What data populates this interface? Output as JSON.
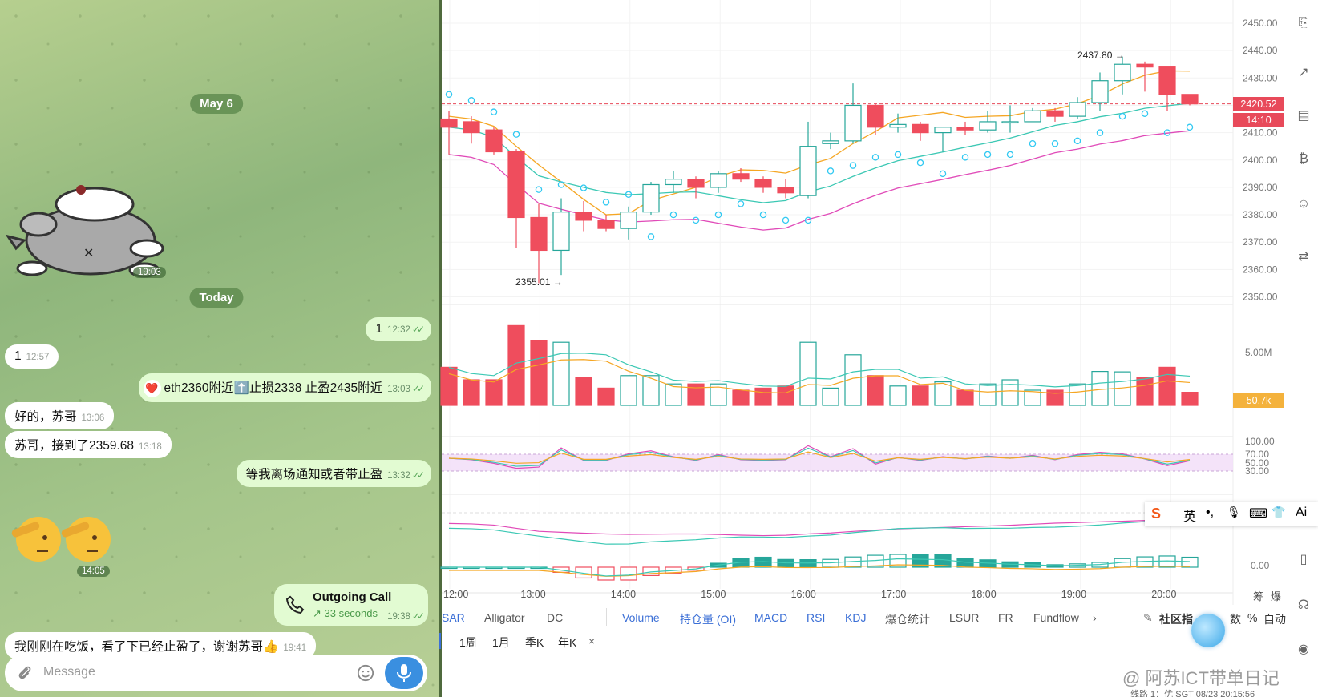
{
  "chat": {
    "date_may": "May 6",
    "date_today": "Today",
    "sticker1_time": "19:03",
    "sticker2_time": "14:05",
    "messages": [
      {
        "text": "1",
        "time": "12:32",
        "dir": "out"
      },
      {
        "text": "1",
        "time": "12:57",
        "dir": "in"
      },
      {
        "text": "eth2360附近⬆️止损2338 止盈2435附近",
        "time": "13:03",
        "dir": "out",
        "reaction": "❤️"
      },
      {
        "text": "好的，苏哥",
        "time": "13:06",
        "dir": "in"
      },
      {
        "text": "苏哥，接到了2359.68",
        "time": "13:18",
        "dir": "in"
      },
      {
        "text": "等我离场通知或者带止盈",
        "time": "13:32",
        "dir": "out"
      },
      {
        "text": "我刚刚在吃饭，看了下已经止盈了，谢谢苏哥👍",
        "time": "19:41",
        "dir": "in"
      }
    ],
    "call": {
      "title": "Outgoing Call",
      "detail": "↗ 33 seconds",
      "time": "19:38"
    },
    "input_placeholder": "Message",
    "icons": {
      "attach": "paperclip-icon",
      "emoji": "emoji-icon",
      "mic": "microphone-icon",
      "call": "phone-icon"
    }
  },
  "chart": {
    "price_axis": [
      "2450.00",
      "2440.00",
      "2430.00",
      "2420.00",
      "2410.00",
      "2400.00",
      "2390.00",
      "2380.00",
      "2370.00",
      "2360.00",
      "2350.00"
    ],
    "current_price": "2420.52",
    "countdown": "14:10",
    "volume_axis": "5.00M",
    "volume_current": "50.7k",
    "rsi_axis": [
      "100.00",
      "70.00",
      "50.00",
      "30.00"
    ],
    "macd_axis": "0.00",
    "time_axis": [
      "12:00",
      "13:00",
      "14:00",
      "15:00",
      "16:00",
      "17:00",
      "18:00",
      "19:00",
      "20:00"
    ],
    "high_label": "2437.80",
    "low_label": "2355.01",
    "chip_label": "筹",
    "burst_label": "爆",
    "colors": {
      "up": "#26a69a",
      "down": "#ef4d5d",
      "price_tag": "#e84a5a",
      "volume_tag": "#f4b23c"
    }
  },
  "chart_data": {
    "type": "candlestick",
    "x": [
      "12:00",
      "12:15",
      "12:30",
      "12:45",
      "13:00",
      "13:15",
      "13:30",
      "13:45",
      "14:00",
      "14:15",
      "14:30",
      "14:45",
      "15:00",
      "15:15",
      "15:30",
      "15:45",
      "16:00",
      "16:15",
      "16:30",
      "16:45",
      "17:00",
      "17:15",
      "17:30",
      "17:45",
      "18:00",
      "18:15",
      "18:30",
      "18:45",
      "19:00",
      "19:15",
      "19:30",
      "19:45",
      "20:00",
      "20:15"
    ],
    "series": [
      {
        "name": "",
        "ohlc": [
          [
            2415,
            2418,
            2402,
            2412
          ],
          [
            2414,
            2416,
            2406,
            2410
          ],
          [
            2411,
            2412,
            2402,
            2403
          ],
          [
            2403,
            2404,
            2368,
            2379
          ],
          [
            2379,
            2384,
            2355,
            2367
          ],
          [
            2367,
            2386,
            2358,
            2381
          ],
          [
            2381,
            2385,
            2374,
            2378
          ],
          [
            2378,
            2380,
            2374,
            2375
          ],
          [
            2375,
            2383,
            2371,
            2381
          ],
          [
            2381,
            2392,
            2380,
            2391
          ],
          [
            2391,
            2396,
            2388,
            2393
          ],
          [
            2393,
            2394,
            2386,
            2390
          ],
          [
            2390,
            2396,
            2388,
            2395
          ],
          [
            2395,
            2397,
            2392,
            2393
          ],
          [
            2393,
            2394,
            2388,
            2390
          ],
          [
            2390,
            2393,
            2386,
            2388
          ],
          [
            2387,
            2414,
            2386,
            2405
          ],
          [
            2406,
            2410,
            2404,
            2407
          ],
          [
            2407,
            2428,
            2406,
            2420
          ],
          [
            2420,
            2421,
            2409,
            2412
          ],
          [
            2412,
            2417,
            2410,
            2413
          ],
          [
            2413,
            2414,
            2407,
            2410
          ],
          [
            2410,
            2412,
            2403,
            2412
          ],
          [
            2412,
            2414,
            2409,
            2411
          ],
          [
            2411,
            2418,
            2410,
            2414
          ],
          [
            2414,
            2420,
            2410,
            2414
          ],
          [
            2414,
            2419,
            2414,
            2418
          ],
          [
            2418,
            2419,
            2414,
            2416
          ],
          [
            2416,
            2423,
            2415,
            2421
          ],
          [
            2421,
            2432,
            2418,
            2429
          ],
          [
            2429,
            2437.8,
            2424,
            2435
          ],
          [
            2435,
            2436,
            2425,
            2434
          ],
          [
            2434,
            2434,
            2418,
            2424
          ],
          [
            2424,
            2424,
            2420,
            2420.52
          ]
        ]
      }
    ],
    "ylim": [
      2345,
      2453
    ],
    "annotations": {
      "high": 2437.8,
      "low": 2355.01,
      "last": 2420.52
    }
  },
  "toolbar": {
    "indicators_left": [
      "SAR",
      "Alligator",
      "DC"
    ],
    "indicators_right": [
      "Volume",
      "持仓量 (OI)",
      "MACD",
      "RSI",
      "KDJ",
      "爆仓统计",
      "LSUR",
      "FR",
      "Fundflow"
    ],
    "community": "社区指",
    "right_items": [
      "数",
      "%",
      "自动"
    ],
    "periods": [
      "1周",
      "1月",
      "季K",
      "年K"
    ],
    "close": "×",
    "more": "›"
  },
  "ime": {
    "labels": [
      "英",
      "•,",
      "🎙",
      "⌨",
      "👕",
      "Ai"
    ],
    "logo": "S"
  },
  "watermark": "@ 阿苏ICT带单日记",
  "status": "线路 1：优    SGT  08/23 20:15:56"
}
